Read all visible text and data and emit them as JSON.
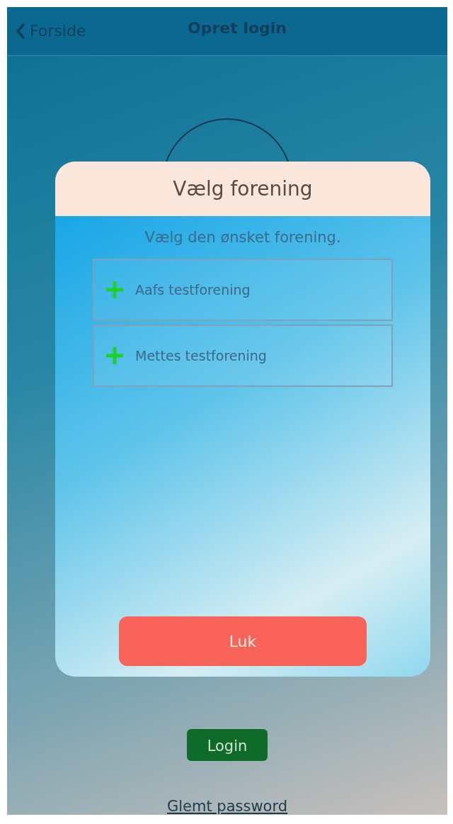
{
  "nav": {
    "back": "Forside",
    "title": "Opret login"
  },
  "login_button": "Login",
  "forgot_link": "Glemt password",
  "dialog": {
    "title": "Vælg forening",
    "subtitle": "Vælg den ønsket forening.",
    "items": [
      {
        "label": "Aafs testforening"
      },
      {
        "label": "Mettes testforening"
      }
    ],
    "close_button": "Luk"
  }
}
